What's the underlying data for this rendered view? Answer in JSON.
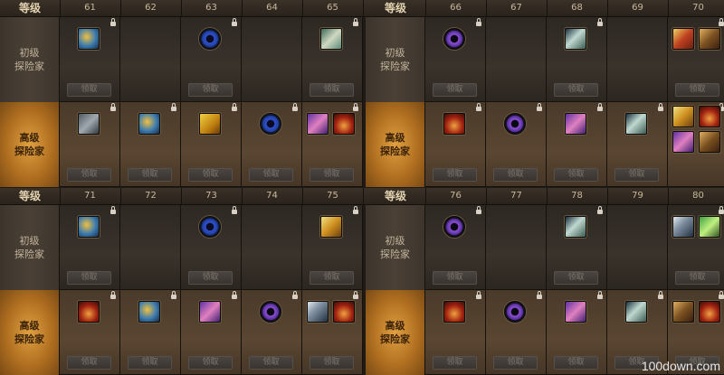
{
  "header_label": "等级",
  "tier_basic": [
    "初级",
    "探险家"
  ],
  "tier_advanced": [
    "高级",
    "探险家"
  ],
  "claim_label": "领取",
  "watermark": "100down.com",
  "panels": [
    {
      "blocks": [
        {
          "levels": [
            "61",
            "62",
            "63",
            "64",
            "65"
          ],
          "basic": [
            [
              "scroll"
            ],
            [],
            [
              "ring-blue"
            ],
            [],
            [
              "map"
            ]
          ],
          "advanced": [
            [
              "crate"
            ],
            [
              "scroll"
            ],
            [
              "chest"
            ],
            [
              "ring-blue"
            ],
            [
              "gem",
              "fire"
            ]
          ]
        },
        {
          "levels": [
            "66",
            "67",
            "68",
            "69",
            "70"
          ],
          "basic": [
            [
              "ring-purple"
            ],
            [],
            [
              "book"
            ],
            [],
            [
              "gift",
              "relic"
            ]
          ],
          "advanced": [
            [
              "fire"
            ],
            [
              "ring-purple"
            ],
            [
              "gem"
            ],
            [
              "book"
            ],
            [
              "gold",
              "fire",
              "gem",
              "relic"
            ]
          ]
        }
      ]
    },
    {
      "blocks": [
        {
          "levels": [
            "71",
            "72",
            "73",
            "74",
            "75"
          ],
          "basic": [
            [
              "scroll"
            ],
            [],
            [
              "ring-blue"
            ],
            [],
            [
              "gold"
            ]
          ],
          "advanced": [
            [
              "fire"
            ],
            [
              "scroll"
            ],
            [
              "gem"
            ],
            [
              "ring-purple"
            ],
            [
              "sword",
              "fire"
            ]
          ]
        },
        {
          "levels": [
            "76",
            "77",
            "78",
            "79",
            "80"
          ],
          "basic": [
            [
              "ring-purple"
            ],
            [],
            [
              "book"
            ],
            [],
            [
              "sword",
              "lime"
            ]
          ],
          "advanced": [
            [
              "fire"
            ],
            [
              "ring-purple"
            ],
            [
              "gem"
            ],
            [
              "book"
            ],
            [
              "relic",
              "fire"
            ]
          ]
        }
      ]
    }
  ]
}
